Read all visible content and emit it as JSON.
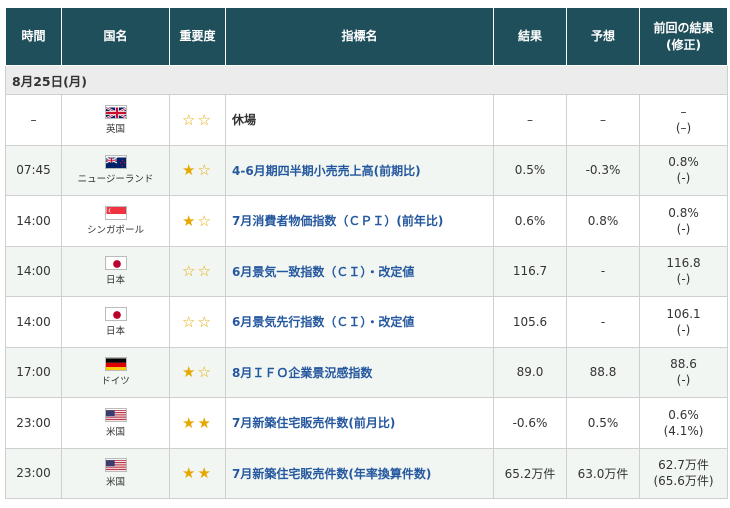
{
  "headers": {
    "time": "時間",
    "country": "国名",
    "importance": "重要度",
    "indicator": "指標名",
    "result": "結果",
    "forecast": "予想",
    "previous_line1": "前回の結果",
    "previous_line2": "(修正)"
  },
  "date_label": "8月25日(月)",
  "colors": {
    "header_bg": "#1f4f5a",
    "link": "#25589e",
    "star": "#e6a800",
    "alt_row": "#f1f6f3"
  },
  "rows": [
    {
      "time": "–",
      "country": "英国",
      "flag": "uk",
      "stars": "☆☆",
      "indicator": "休場",
      "result": "–",
      "forecast": "–",
      "prev": "–",
      "prev_rev": "(–)"
    },
    {
      "time": "07:45",
      "country": "ニュージーランド",
      "flag": "nz",
      "stars": "★☆",
      "indicator": "4-6月期四半期小売売上高(前期比)",
      "result": "0.5%",
      "forecast": "-0.3%",
      "prev": "0.8%",
      "prev_rev": "(-)"
    },
    {
      "time": "14:00",
      "country": "シンガポール",
      "flag": "sg",
      "stars": "★☆",
      "indicator": "7月消費者物価指数（ＣＰＩ）(前年比)",
      "result": "0.6%",
      "forecast": "0.8%",
      "prev": "0.8%",
      "prev_rev": "(-)"
    },
    {
      "time": "14:00",
      "country": "日本",
      "flag": "jp",
      "stars": "☆☆",
      "indicator": "6月景気一致指数（ＣＩ）・改定値",
      "result": "116.7",
      "forecast": "-",
      "prev": "116.8",
      "prev_rev": "(-)"
    },
    {
      "time": "14:00",
      "country": "日本",
      "flag": "jp",
      "stars": "☆☆",
      "indicator": "6月景気先行指数（ＣＩ）・改定値",
      "result": "105.6",
      "forecast": "-",
      "prev": "106.1",
      "prev_rev": "(-)"
    },
    {
      "time": "17:00",
      "country": "ドイツ",
      "flag": "de",
      "stars": "★☆",
      "indicator": "8月ＩＦＯ企業景況感指数",
      "result": "89.0",
      "forecast": "88.8",
      "prev": "88.6",
      "prev_rev": "(-)"
    },
    {
      "time": "23:00",
      "country": "米国",
      "flag": "us",
      "stars": "★★",
      "indicator": "7月新築住宅販売件数(前月比)",
      "result": "-0.6%",
      "forecast": "0.5%",
      "prev": "0.6%",
      "prev_rev": "(4.1%)"
    },
    {
      "time": "23:00",
      "country": "米国",
      "flag": "us",
      "stars": "★★",
      "indicator": "7月新築住宅販売件数(年率換算件数)",
      "result": "65.2万件",
      "forecast": "63.0万件",
      "prev": "62.7万件",
      "prev_rev": "(65.6万件)"
    }
  ]
}
